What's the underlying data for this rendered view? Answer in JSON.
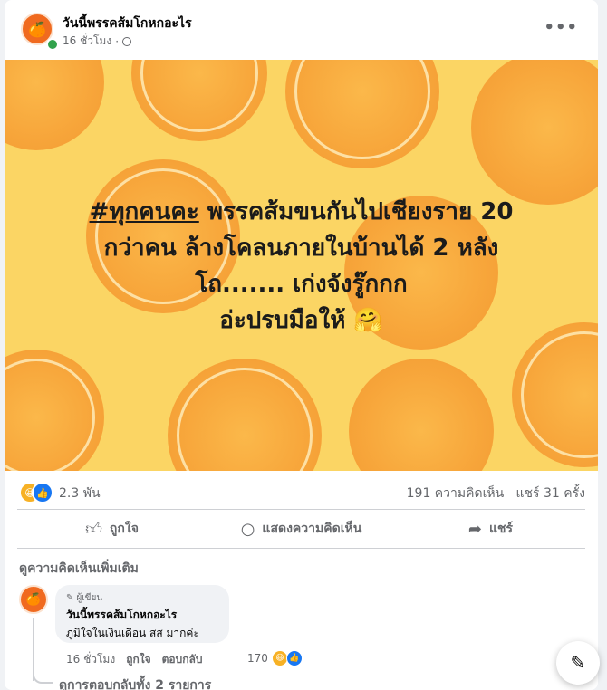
{
  "post": {
    "page_name": "วันนี้พรรคส้มโกหกอะไร",
    "time": "16 ชั่วโมง",
    "privacy_icon": "globe-icon",
    "hashtag": "#ทุกคนคะ",
    "text_line1_rest": " พรรคส้มขนกันไปเชียงราย 20",
    "text_line2": "กว่าคน ล้างโคลนภายในบ้านได้ 2 หลัง",
    "text_line3": "โถ....... เก่งจังรู๊กกก",
    "text_line4": "อ่ะปรบมือให้ 🤗"
  },
  "reactions": {
    "count": "2.3 พัน",
    "comments": "191 ความคิดเห็น",
    "shares": "แชร์ 31 ครั้ง"
  },
  "actions": {
    "like": "ถูกใจ",
    "comment": "แสดงความคิดเห็น",
    "share": "แชร์"
  },
  "comments_section": {
    "view_more": "ดูความคิดเห็นเพิ่มเติม",
    "comment": {
      "badge": "ผู้เขียน",
      "author": "วันนี้พรรคส้มโกหกอะไร",
      "text": "ภูมิใจในเงินเดือน สส มากค่ะ",
      "time": "16 ชั่วโมง",
      "like": "ถูกใจ",
      "reply": "ตอบกลับ",
      "reaction_count": "170"
    },
    "replies_link": "ดูการตอบกลับทั้ง 2 รายการ"
  },
  "colors": {
    "accent": "#1877f2",
    "brand_orange": "#f06a1f",
    "image_bg": "#fbd564"
  }
}
